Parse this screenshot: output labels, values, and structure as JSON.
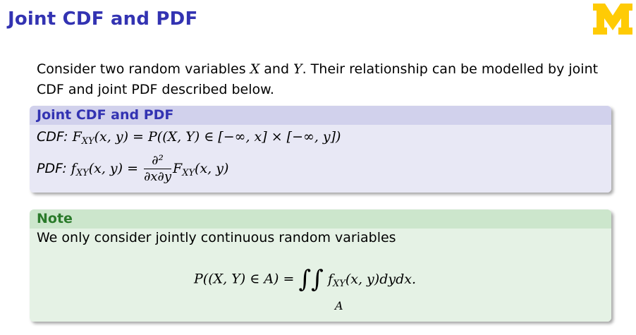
{
  "slide": {
    "title": "Joint CDF and PDF"
  },
  "intro": {
    "line1_pre": "Consider two random variables ",
    "var_x": "X",
    "and": " and ",
    "var_y": "Y",
    "line1_post": ". Their relationship can be modelled by joint",
    "line2": "CDF and joint PDF described below."
  },
  "block_definition": {
    "header": "Joint CDF and PDF",
    "cdf_label": "CDF:",
    "cdf_lhs": "F",
    "cdf_sub": "XY",
    "cdf_args": "(x, y) = P((X, Y) ∈ [−∞, x] × [−∞, y])",
    "pdf_label": "PDF:",
    "pdf_lhs": "f",
    "pdf_sub": "XY",
    "pdf_args": "(x, y) =",
    "pdf_num": "∂²",
    "pdf_den": "∂x∂y",
    "pdf_rhs": "F",
    "pdf_rhs_sub": "XY",
    "pdf_rhs_args": "(x, y)"
  },
  "block_note": {
    "header": "Note",
    "text": "We only consider jointly continuous random variables",
    "eq_lhs": "P((X, Y) ∈ A) =",
    "integral": "∫∫",
    "region": "A",
    "integrand": "f",
    "integrand_sub": "XY",
    "integrand_args": "(x, y)dydx."
  },
  "colors": {
    "title": "#3333b2",
    "logo_maize": "#ffcb05",
    "def_header_bg": "#d1d1ec",
    "def_body_bg": "#e8e8f5",
    "note_header_bg": "#cce6cc",
    "note_body_bg": "#e5f2e5",
    "note_header_text": "#2a7a2a"
  }
}
